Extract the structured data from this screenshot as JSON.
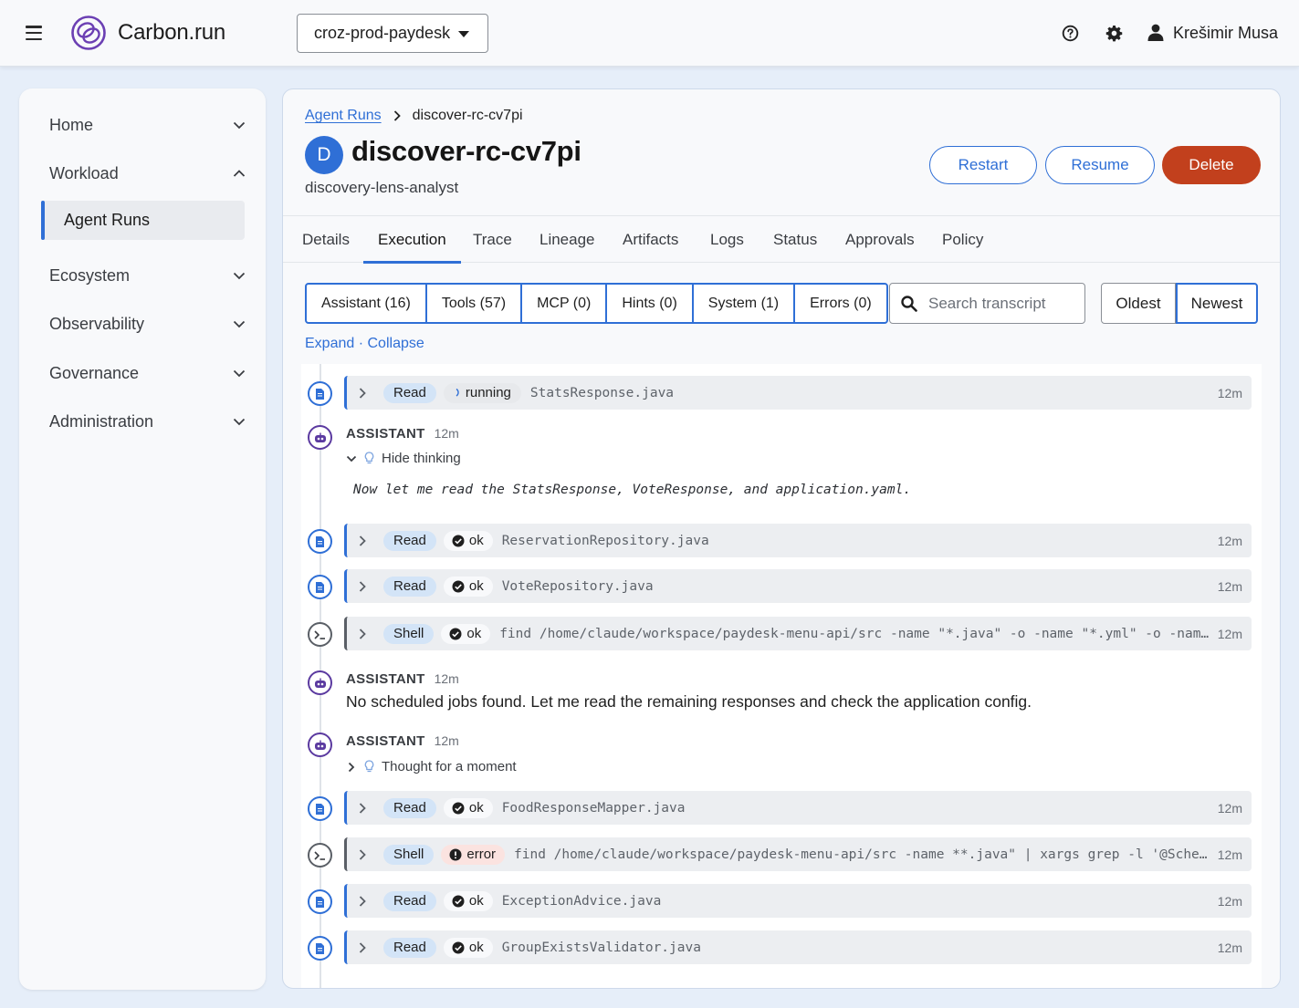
{
  "topbar": {
    "brand": "Carbon.run",
    "project": "croz-prod-paydesk",
    "user_name": "Krešimir Musa"
  },
  "sidebar": {
    "items": [
      {
        "label": "Home",
        "expanded": false
      },
      {
        "label": "Workload",
        "expanded": true
      },
      {
        "label": "Ecosystem",
        "expanded": false
      },
      {
        "label": "Observability",
        "expanded": false
      },
      {
        "label": "Governance",
        "expanded": false
      },
      {
        "label": "Administration",
        "expanded": false
      }
    ],
    "active_sub": "Agent Runs"
  },
  "header": {
    "breadcrumb_parent": "Agent Runs",
    "breadcrumb_current": "discover-rc-cv7pi",
    "avatar_letter": "D",
    "title": "discover-rc-cv7pi",
    "subtitle": "discovery-lens-analyst",
    "restart_label": "Restart",
    "resume_label": "Resume",
    "delete_label": "Delete"
  },
  "tabs": [
    "Details",
    "Execution",
    "Trace",
    "Lineage",
    "Artifacts",
    "Logs",
    "Status",
    "Approvals",
    "Policy"
  ],
  "active_tab": "Execution",
  "filters": [
    "Assistant (16)",
    "Tools (57)",
    "MCP (0)",
    "Hints (0)",
    "System (1)",
    "Errors (0)"
  ],
  "search": {
    "placeholder": "Search transcript"
  },
  "sort": {
    "oldest": "Oldest",
    "newest": "Newest"
  },
  "expand": {
    "expand": "Expand",
    "dot": "·",
    "collapse": "Collapse"
  },
  "transcript": {
    "rows": [
      {
        "kind": "Read",
        "status": "running",
        "text": "StatsResponse.java",
        "time": "12m"
      },
      {
        "role": "ASSISTANT",
        "time": "12m",
        "toggle": "Hide thinking",
        "thinking": "Now let me read the StatsResponse, VoteResponse, and application.yaml."
      },
      {
        "kind": "Read",
        "status": "ok",
        "text": "ReservationRepository.java",
        "time": "12m"
      },
      {
        "kind": "Read",
        "status": "ok",
        "text": "VoteRepository.java",
        "time": "12m"
      },
      {
        "kind": "Shell",
        "status": "ok",
        "text": "find /home/claude/workspace/paydesk-menu-api/src -name \"*.java\" -o -name \"*.yml\" -o -name \"*.yaml\"",
        "time": "12m"
      },
      {
        "role": "ASSISTANT",
        "time": "12m",
        "message": "No scheduled jobs found. Let me read the remaining responses and check the application config."
      },
      {
        "role": "ASSISTANT",
        "time": "12m",
        "toggle": "Thought for a moment"
      },
      {
        "kind": "Read",
        "status": "ok",
        "text": "FoodResponseMapper.java",
        "time": "12m"
      },
      {
        "kind": "Shell",
        "status": "error",
        "text": "find /home/claude/workspace/paydesk-menu-api/src -name **.java\" | xargs grep -l '@Scheduled\\|@EnableScheduling'",
        "time": "12m"
      },
      {
        "kind": "Read",
        "status": "ok",
        "text": "ExceptionAdvice.java",
        "time": "12m"
      },
      {
        "kind": "Read",
        "status": "ok",
        "text": "GroupExistsValidator.java",
        "time": "12m"
      }
    ]
  },
  "colors": {
    "accent": "#2f6fd6",
    "danger": "#c2401d",
    "assistant": "#5b3aa0"
  }
}
